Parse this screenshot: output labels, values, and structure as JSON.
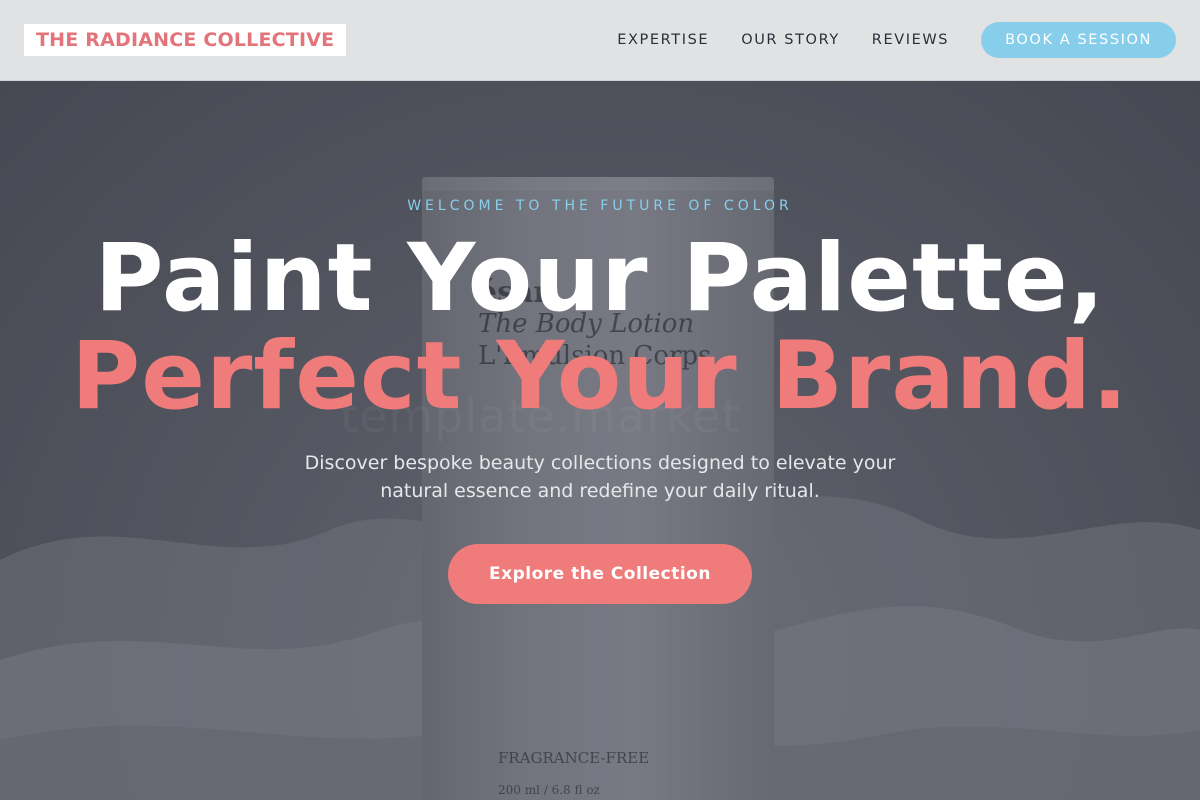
{
  "header": {
    "logo": "THE RADIANCE COLLECTIVE",
    "nav": [
      "EXPERTISE",
      "OUR STORY",
      "REVIEWS"
    ],
    "cta": "BOOK A SESSION"
  },
  "hero": {
    "eyebrow": "WELCOME TO THE FUTURE OF COLOR",
    "headline_line1": "Paint Your Palette,",
    "headline_line2": "Perfect Your Brand.",
    "subtext": "Discover bespoke beauty collections designed to elevate your natural essence and redefine your daily ritual.",
    "cta": "Explore the Collection",
    "background_product": {
      "brand": "ésar",
      "name": "The Body Lotion",
      "name_fr": "L'Emulsion Corps",
      "watermark": "template.market",
      "tag": "FRAGRANCE-FREE",
      "volume": "200 ml / 6.8 fl oz"
    }
  },
  "colors": {
    "brand_pink": "#f07b7b",
    "accent_sky": "#87ceeb",
    "header_bg": "#e1e2e4"
  }
}
